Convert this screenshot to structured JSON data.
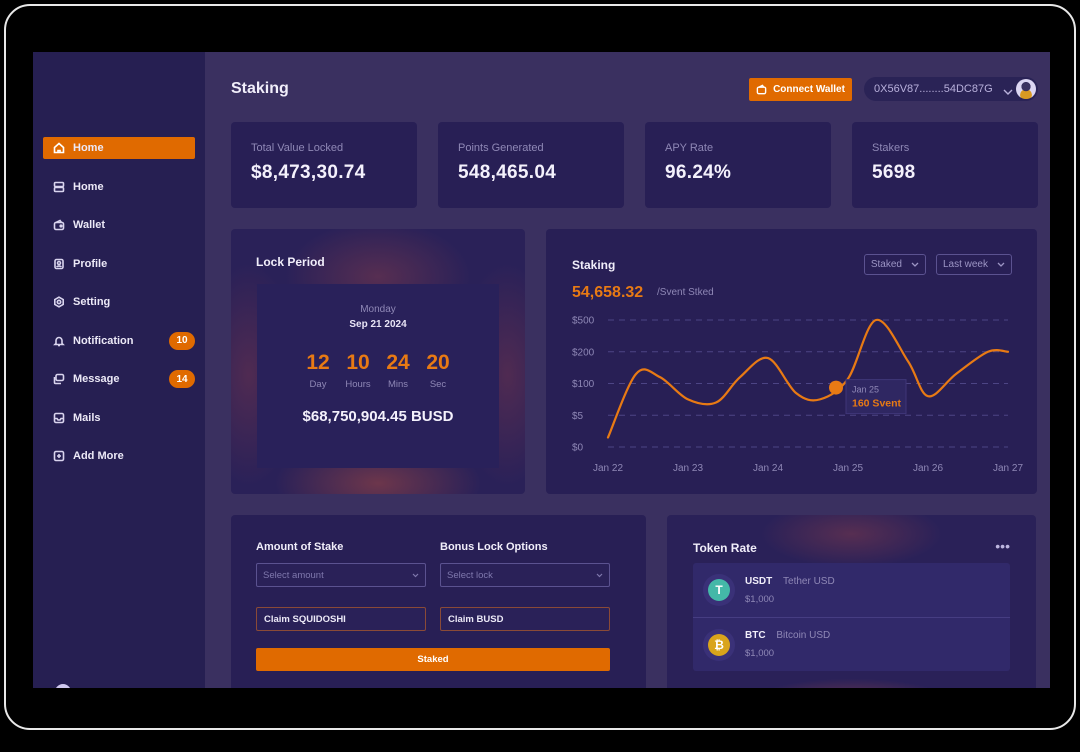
{
  "header": {
    "title": "Staking",
    "connect_wallet_label": "Connect Wallet",
    "wallet_address": "0X56V87........54DC87G"
  },
  "sidebar": {
    "items": [
      {
        "label": "Home",
        "icon": "home-icon",
        "active": true
      },
      {
        "label": "Home",
        "icon": "server-icon"
      },
      {
        "label": "Wallet",
        "icon": "wallet-icon"
      },
      {
        "label": "Profile",
        "icon": "profile-icon"
      },
      {
        "label": "Setting",
        "icon": "gear-icon"
      },
      {
        "label": "Notification",
        "icon": "bell-icon",
        "badge": "10"
      },
      {
        "label": "Message",
        "icon": "message-icon",
        "badge": "14"
      },
      {
        "label": "Mails",
        "icon": "mail-icon"
      },
      {
        "label": "Add More",
        "icon": "plus-square-icon"
      }
    ]
  },
  "stats": [
    {
      "label": "Total Value Locked",
      "value": "$8,473,30.74"
    },
    {
      "label": "Points Generated",
      "value": "548,465.04"
    },
    {
      "label": "APY Rate",
      "value": "96.24%"
    },
    {
      "label": "Stakers",
      "value": "5698"
    }
  ],
  "lock_period": {
    "title": "Lock Period",
    "weekday": "Monday",
    "date": "Sep 21 2024",
    "countdown": [
      {
        "value": "12",
        "unit": "Day"
      },
      {
        "value": "10",
        "unit": "Hours"
      },
      {
        "value": "24",
        "unit": "Mins"
      },
      {
        "value": "20",
        "unit": "Sec"
      }
    ],
    "amount": "$68,750,904.45 BUSD"
  },
  "staking_chart": {
    "title": "Staking",
    "total": "54,658.32",
    "total_suffix": "/Svent Stked",
    "filter_type": "Staked",
    "filter_range": "Last week",
    "tooltip": {
      "date": "Jan 25",
      "value": "160 Svent"
    }
  },
  "chart_data": {
    "type": "line",
    "title": "Staking",
    "xlabel": "",
    "ylabel": "",
    "categories": [
      "Jan 22",
      "Jan 23",
      "Jan 24",
      "Jan 25",
      "Jan 26",
      "Jan 27"
    ],
    "y_ticks": [
      "$500",
      "$200",
      "$100",
      "$5",
      "$0"
    ],
    "grid": true,
    "series": [
      {
        "name": "Staked",
        "color": "#e87a14",
        "x": [
          0.0,
          0.35,
          0.65,
          1.0,
          1.35,
          1.65,
          2.0,
          2.35,
          2.65,
          3.0,
          3.35,
          3.75,
          4.0,
          4.35,
          4.75,
          5.0
        ],
        "y_level": [
          0.3,
          2.3,
          2.2,
          1.5,
          1.4,
          2.2,
          2.8,
          1.7,
          1.5,
          2.15,
          4.0,
          2.7,
          1.6,
          2.3,
          3.0,
          3.0
        ]
      }
    ],
    "highlight": {
      "x": 2.85,
      "label": "Jan 25",
      "value": "160 Svent"
    }
  },
  "stake_form": {
    "amount_label": "Amount of Stake",
    "amount_placeholder": "Select amount",
    "lock_label": "Bonus Lock Options",
    "lock_placeholder": "Select lock",
    "claim_left": "Claim SQUIDOSHI",
    "claim_right": "Claim BUSD",
    "submit_label": "Staked"
  },
  "token_rate": {
    "title": "Token Rate",
    "more_label": "•••",
    "tokens": [
      {
        "symbol": "USDT",
        "name": "Tether USD",
        "price": "$1,000",
        "glyph": "T",
        "color": "#44b8a8"
      },
      {
        "symbol": "BTC",
        "name": "Bitcoin USD",
        "price": "$1,000",
        "glyph": "₿",
        "color": "#d9a41b"
      }
    ]
  },
  "colors": {
    "accent": "#e06a00",
    "sidebar_bg": "#261f52",
    "page_bg": "#3a3060",
    "card_bg": "#281f55"
  }
}
